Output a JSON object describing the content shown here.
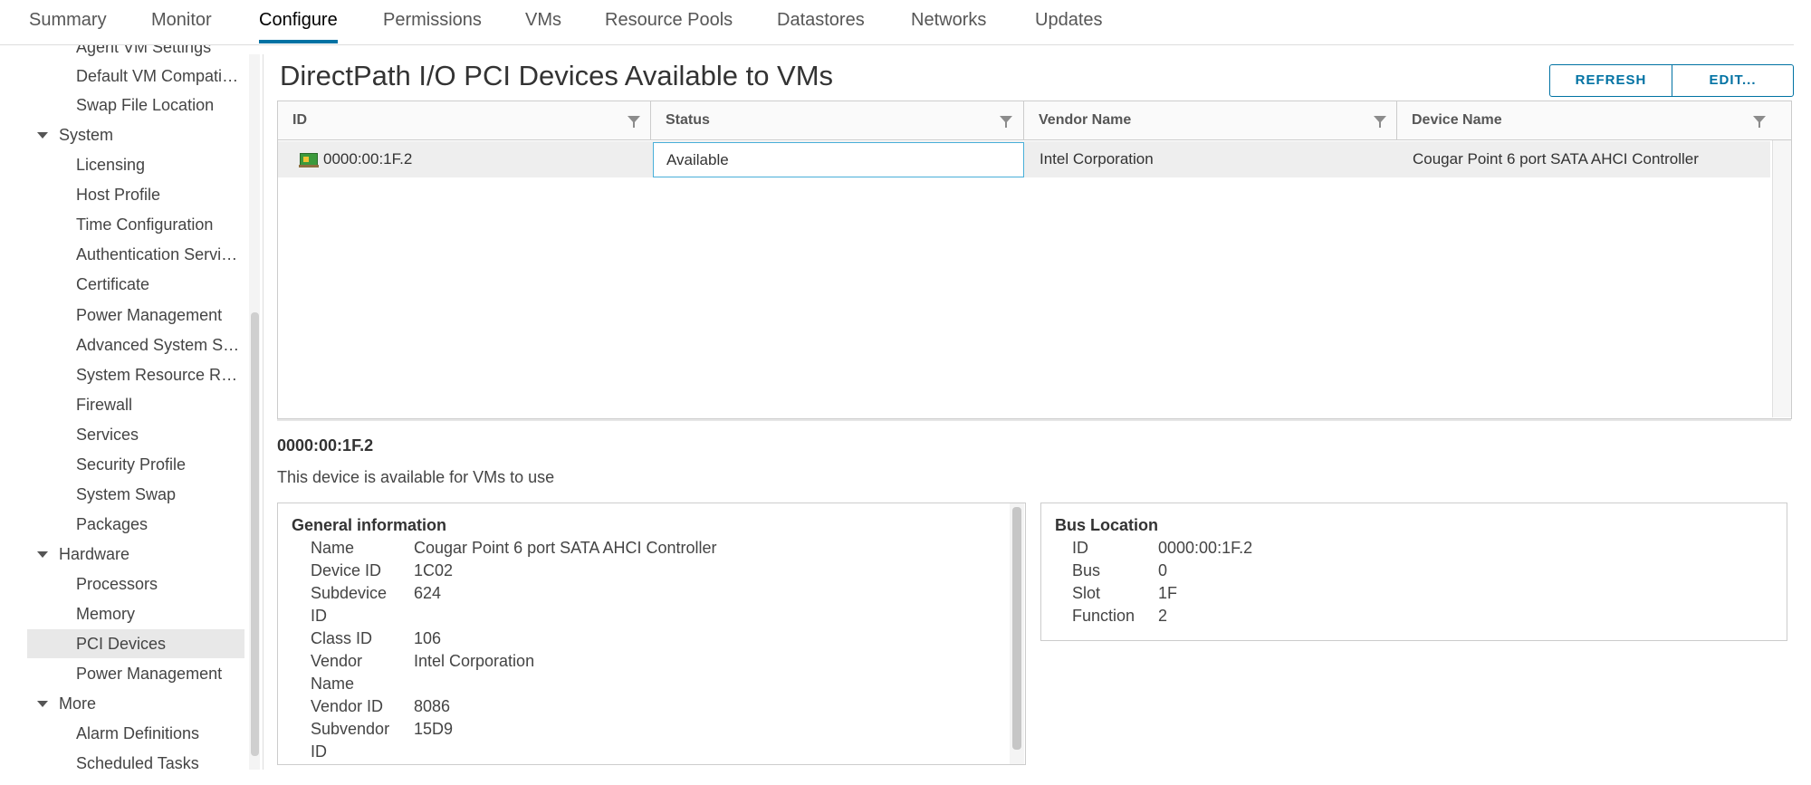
{
  "tabs": [
    "Summary",
    "Monitor",
    "Configure",
    "Permissions",
    "VMs",
    "Resource Pools",
    "Datastores",
    "Networks",
    "Updates"
  ],
  "active_tab": "Configure",
  "sidebar": {
    "items": [
      {
        "label": "Agent VM Settings",
        "section": false
      },
      {
        "label": "Default VM Compatibility",
        "section": false
      },
      {
        "label": "Swap File Location",
        "section": false
      },
      {
        "label": "System",
        "section": true
      },
      {
        "label": "Licensing",
        "section": false
      },
      {
        "label": "Host Profile",
        "section": false
      },
      {
        "label": "Time Configuration",
        "section": false
      },
      {
        "label": "Authentication Services",
        "section": false
      },
      {
        "label": "Certificate",
        "section": false
      },
      {
        "label": "Power Management",
        "section": false
      },
      {
        "label": "Advanced System Settings",
        "section": false
      },
      {
        "label": "System Resource Reservation",
        "section": false
      },
      {
        "label": "Firewall",
        "section": false
      },
      {
        "label": "Services",
        "section": false
      },
      {
        "label": "Security Profile",
        "section": false
      },
      {
        "label": "System Swap",
        "section": false
      },
      {
        "label": "Packages",
        "section": false
      },
      {
        "label": "Hardware",
        "section": true
      },
      {
        "label": "Processors",
        "section": false
      },
      {
        "label": "Memory",
        "section": false
      },
      {
        "label": "PCI Devices",
        "section": false,
        "selected": true
      },
      {
        "label": "Power Management",
        "section": false
      },
      {
        "label": "More",
        "section": true
      },
      {
        "label": "Alarm Definitions",
        "section": false
      },
      {
        "label": "Scheduled Tasks",
        "section": false
      }
    ]
  },
  "main": {
    "title": "DirectPath I/O PCI Devices Available to VMs",
    "buttons": {
      "refresh": "REFRESH",
      "edit": "EDIT..."
    },
    "grid": {
      "columns": [
        "ID",
        "Status",
        "Vendor Name",
        "Device Name"
      ],
      "rows": [
        {
          "id": "0000:00:1F.2",
          "status": "Available",
          "vendor": "Intel Corporation",
          "device": "Cougar Point 6 port SATA AHCI Controller"
        }
      ]
    },
    "detail": {
      "id": "0000:00:1F.2",
      "description": "This device is available for VMs to use",
      "general": {
        "title": "General information",
        "fields": [
          {
            "key": "Name",
            "value": "Cougar Point 6 port SATA AHCI Controller"
          },
          {
            "key": "Device ID",
            "value": "1C02"
          },
          {
            "key": "Subdevice ID",
            "value": "624"
          },
          {
            "key": "Class ID",
            "value": "106"
          },
          {
            "key": "Vendor Name",
            "value": "Intel Corporation"
          },
          {
            "key": "Vendor ID",
            "value": "8086"
          },
          {
            "key": "Subvendor ID",
            "value": "15D9"
          }
        ]
      },
      "bus": {
        "title": "Bus Location",
        "fields": [
          {
            "key": "ID",
            "value": "0000:00:1F.2"
          },
          {
            "key": "Bus",
            "value": "0"
          },
          {
            "key": "Slot",
            "value": "1F"
          },
          {
            "key": "Function",
            "value": "2"
          }
        ]
      }
    }
  },
  "colors": {
    "accent": "#0072a3",
    "selection_border": "#49afd9",
    "selected_row": "#eeeeee"
  }
}
